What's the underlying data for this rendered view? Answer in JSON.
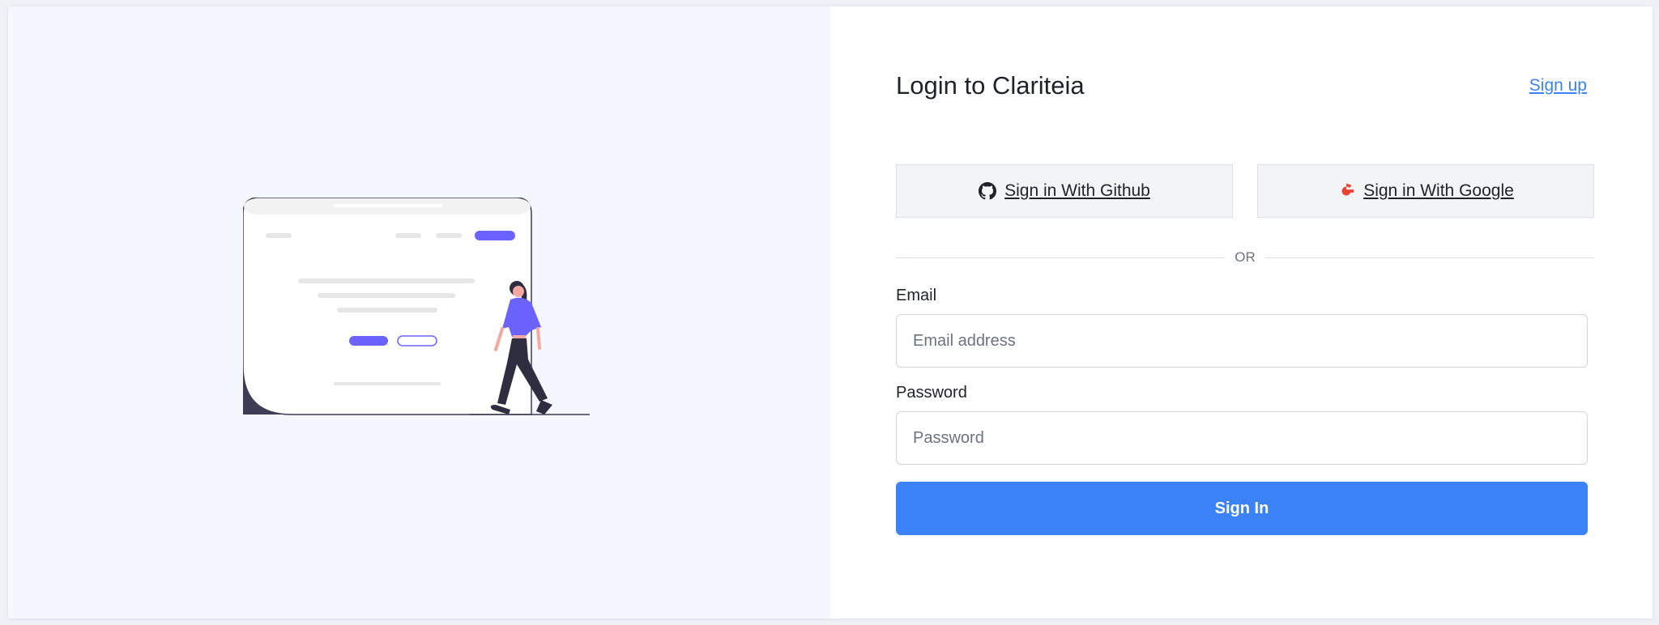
{
  "header": {
    "title": "Login to Clariteia",
    "signup_label": "Sign up"
  },
  "oauth": {
    "github_label": "Sign in With Github",
    "google_label": "Sign in With Google"
  },
  "divider": {
    "text": "OR"
  },
  "form": {
    "email_label": "Email",
    "email_placeholder": "Email address",
    "email_value": "",
    "password_label": "Password",
    "password_placeholder": "Password",
    "password_value": "",
    "submit_label": "Sign In"
  },
  "icons": {
    "github": "github-icon",
    "google": "google-icon"
  },
  "colors": {
    "accent": "#3b82f6",
    "illustration_accent": "#6c63ff",
    "left_panel_bg": "#f4f7fd",
    "google_red": "#ea4335"
  }
}
